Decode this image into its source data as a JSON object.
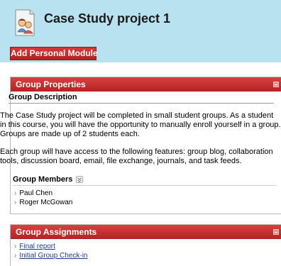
{
  "page": {
    "title": "Case Study project 1",
    "icon": "group-people-icon",
    "add_module_label": "Add Personal Module"
  },
  "colors": {
    "header_band": "#b9e2f0",
    "module_header": "#c32d2d",
    "link": "#1d3e90"
  },
  "group_properties": {
    "title": "Group Properties",
    "description_heading": "Group Description",
    "paragraph1": "The Case Study project will be completed in small student groups. As a student in this course, you will have the opportunity to manually enroll yourself in a group. Groups are made up of 2 students each.",
    "paragraph2": "Each group will have access to the following features: group blog, collaboration tools, discussion board, email, file exchange, journals, and task feeds.",
    "members_heading": "Group Members",
    "members": [
      "Paul Chen",
      "Roger McGowan"
    ]
  },
  "group_assignments": {
    "title": "Group Assignments",
    "items": [
      "Final report",
      "Initial Group Check-in"
    ]
  }
}
